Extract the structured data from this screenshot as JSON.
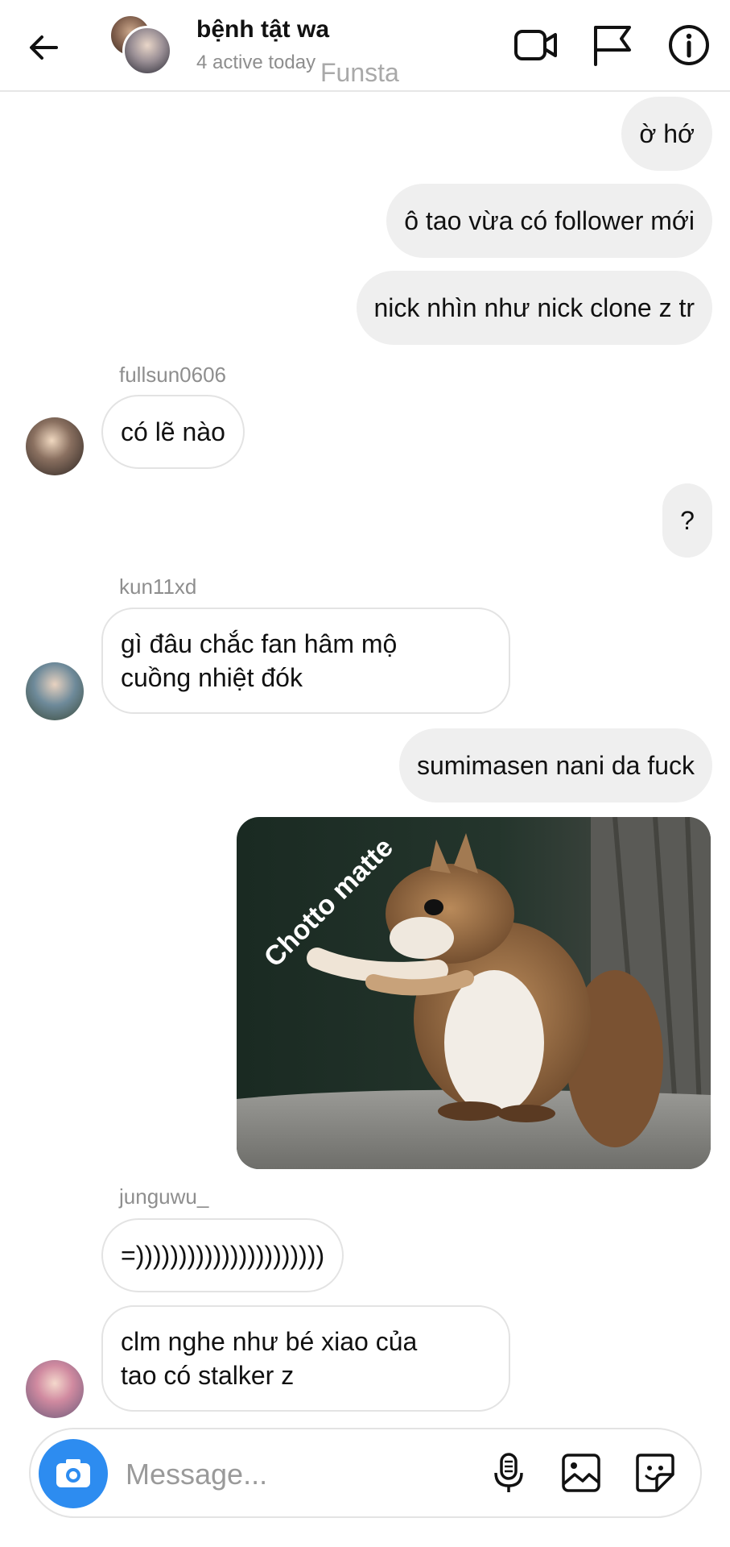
{
  "header": {
    "title": "bệnh tật wa",
    "subtitle": "4 active today",
    "watermark": "Funsta"
  },
  "messages": {
    "m1": "ờ hớ",
    "m2": "ô tao vừa có follower mới",
    "m3": "nick nhìn như nick clone z tr",
    "s1": "fullsun0606",
    "m4": "có lẽ nào",
    "m5": "?",
    "s2": "kun11xd",
    "m6_line1": "gì đâu chắc fan hâm mộ",
    "m6_line2": "cuồng nhiệt đók",
    "m7": "sumimasen nani da fuck",
    "image_caption": "Chotto matte",
    "s3": "junguwu_",
    "m8": "=))))))))))))))))))))))",
    "m9_line1": "clm nghe như bé xiao của",
    "m9_line2": "tao có stalker z"
  },
  "composer": {
    "placeholder": "Message..."
  },
  "icons": {
    "back": "arrow-left-icon",
    "video": "video-camera-icon",
    "flag": "flag-icon",
    "info": "info-icon",
    "camera": "camera-icon",
    "mic": "microphone-icon",
    "gallery": "image-icon",
    "sticker": "sticker-icon"
  },
  "colors": {
    "accent": "#2d8cf0",
    "outgoing_bubble": "#efefef",
    "incoming_border": "#e3e3e3",
    "muted_text": "#8e8e8e"
  }
}
